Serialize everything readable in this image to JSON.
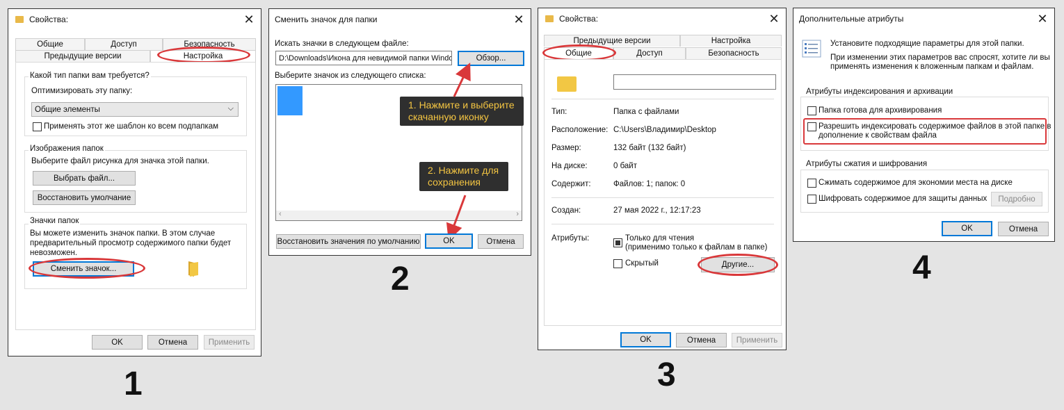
{
  "w1": {
    "title": "Свойства:",
    "tabs_top": [
      "Общие",
      "Доступ",
      "Безопасность"
    ],
    "tabs_bottom": [
      "Предыдущие версии",
      "Настройка"
    ],
    "g1_label": "Какой тип папки вам требуется?",
    "optimize_label": "Оптимизировать эту папку:",
    "select_value": "Общие элементы",
    "apply_template": "Применять этот же шаблон ко всем подпапкам",
    "g2_label": "Изображения папок",
    "g2_desc": "Выберите файл рисунка для значка этой папки.",
    "choose_file": "Выбрать файл...",
    "restore_default": "Восстановить умолчание",
    "g3_label": "Значки папок",
    "g3_desc_1": "Вы можете изменить значок папки. В этом случае",
    "g3_desc_2": "предварительный просмотр содержимого папки будет",
    "g3_desc_3": "невозможен.",
    "change_icon": "Сменить значок...",
    "ok": "OK",
    "cancel": "Отмена",
    "apply": "Применить",
    "number": "1"
  },
  "w2": {
    "title": "Сменить значок для папки",
    "search_label": "Искать значки в следующем файле:",
    "file_path": "D:\\Downloads\\Икона для невидимой папки Windo",
    "browse": "Обзор...",
    "list_label": "Выберите значок из следующего списка:",
    "tip1_line1": "1. Нажмите и выберите",
    "tip1_line2": "скачанную иконку",
    "tip2_line1": "2. Нажмите для",
    "tip2_line2": "сохранения",
    "restore_defaults": "Восстановить значения по умолчанию",
    "ok": "OK",
    "cancel": "Отмена",
    "number": "2",
    "icon_color": "#3399ff"
  },
  "w3": {
    "title": "Свойства:",
    "tabs_top": [
      "Предыдущие версии",
      "Настройка"
    ],
    "tabs_bottom": [
      "Общие",
      "Доступ",
      "Безопасность"
    ],
    "rows": [
      {
        "label": "Тип:",
        "value": "Папка с файлами"
      },
      {
        "label": "Расположение:",
        "value": "C:\\Users\\Владимир\\Desktop"
      },
      {
        "label": "Размер:",
        "value": "132 байт (132 байт)"
      },
      {
        "label": "На диске:",
        "value": "0 байт"
      },
      {
        "label": "Содержит:",
        "value": "Файлов: 1; папок: 0"
      }
    ],
    "created_label": "Создан:",
    "created_value": "27 мая 2022 г., 12:17:23",
    "attrs_label": "Атрибуты:",
    "readonly": "Только для чтения",
    "readonly_note": "(применимо только к файлам в папке)",
    "hidden": "Скрытый",
    "other": "Другие...",
    "ok": "OK",
    "cancel": "Отмена",
    "apply": "Применить",
    "number": "3"
  },
  "w4": {
    "title": "Дополнительные атрибуты",
    "intro_1": "Установите подходящие параметры для этой папки.",
    "intro_2": "При изменении этих параметров вас спросят, хотите ли вы",
    "intro_3": "применять изменения к вложенным папкам и файлам.",
    "g1_label": "Атрибуты индексирования и архивации",
    "archive": "Папка готова для архивирования",
    "index_1": "Разрешить индексировать содержимое файлов в этой папке в",
    "index_2": "дополнение к свойствам файла",
    "g2_label": "Атрибуты сжатия и шифрования",
    "compress": "Сжимать содержимое для экономии места на диске",
    "encrypt": "Шифровать содержимое для защиты данных",
    "details": "Подробно",
    "ok": "OK",
    "cancel": "Отмена",
    "number": "4"
  }
}
